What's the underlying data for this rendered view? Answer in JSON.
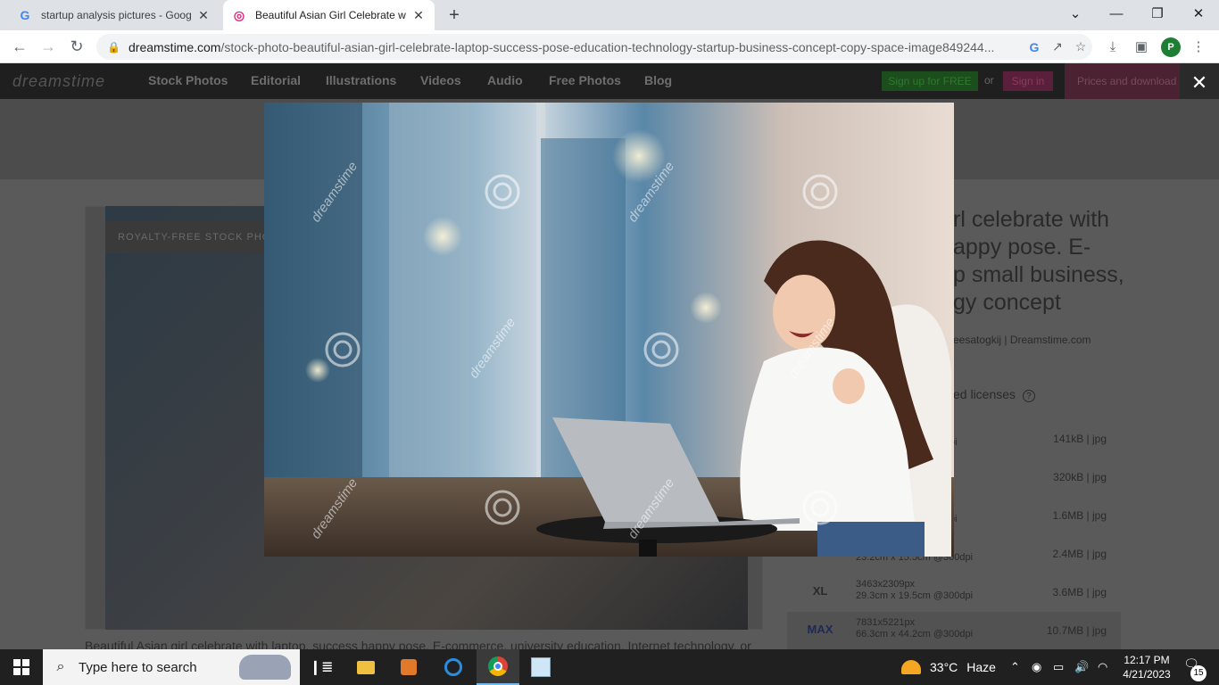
{
  "browser": {
    "tabs": [
      {
        "title": "startup analysis pictures - Google",
        "favicon": "google-g-icon"
      },
      {
        "title": "Beautiful Asian Girl Celebrate wit",
        "favicon": "dreamstime-icon"
      }
    ],
    "url_host": "dreamstime.com",
    "url_path": "/stock-photo-beautiful-asian-girl-celebrate-laptop-success-pose-education-technology-startup-business-concept-copy-space-image849244...",
    "profile_initial": "P"
  },
  "site": {
    "logo": "dreamstime",
    "nav": [
      "Stock Photos",
      "Editorial",
      "Illustrations",
      "Videos",
      "Audio",
      "Free Photos",
      "Blog"
    ],
    "signup": "Sign up for FREE",
    "or": "or",
    "signin": "Sign in",
    "prices": "Prices and download plans",
    "badge": "ROYALTY-FREE STOCK PHOTO",
    "title_lines": [
      "rl celebrate with",
      "appy pose. E-",
      "p small business,",
      "gy concept"
    ],
    "author": "eesatogkij | Dreamstime.com",
    "licenses": "ed licenses",
    "caption": "Beautiful Asian girl celebrate with laptop, success happy pose. E-commerce, university education, Internet technology, or",
    "sizes": [
      {
        "code": "",
        "dim1": "",
        "dim2": "pi",
        "file": "141kB | jpg"
      },
      {
        "code": "",
        "dim1": "",
        "dim2": "",
        "file": "320kB | jpg"
      },
      {
        "code": "",
        "dim1": "",
        "dim2": "pi",
        "file": "1.6MB | jpg"
      },
      {
        "code": "",
        "dim1": "",
        "dim2": "23.2cm x 15.5cm @300dpi",
        "file": "2.4MB | jpg"
      },
      {
        "code": "XL",
        "dim1": "3463x2309px",
        "dim2": "29.3cm x 19.5cm @300dpi",
        "file": "3.6MB | jpg"
      },
      {
        "code": "MAX",
        "dim1": "7831x5221px",
        "dim2": "66.3cm x 44.2cm @300dpi",
        "file": "10.7MB | jpg"
      }
    ]
  },
  "modal": {
    "watermark": "dreamstime"
  },
  "taskbar": {
    "search_placeholder": "Type here to search",
    "weather_temp": "33°C",
    "weather_text": "Haze",
    "time": "12:17 PM",
    "date": "4/21/2023",
    "notification_count": "15"
  }
}
